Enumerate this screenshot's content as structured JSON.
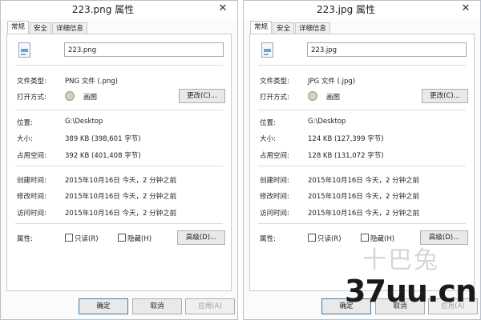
{
  "windows": [
    {
      "title": "223.png 属性",
      "close_glyph": "✕",
      "tabs": [
        "常规",
        "安全",
        "详细信息"
      ],
      "filename": "223.png",
      "fields": {
        "type_label": "文件类型:",
        "type_value": "PNG 文件 (.png)",
        "open_label": "打开方式:",
        "open_value": "画图",
        "change_button": "更改(C)...",
        "location_label": "位置:",
        "location_value": "G:\\Desktop",
        "size_label": "大小:",
        "size_value": "389 KB (398,601 字节)",
        "disk_label": "占用空间:",
        "disk_value": "392 KB (401,408 字节)",
        "created_label": "创建时间:",
        "created_value": "2015年10月16日 今天，2 分钟之前",
        "modified_label": "修改时间:",
        "modified_value": "2015年10月16日 今天，2 分钟之前",
        "accessed_label": "访问时间:",
        "accessed_value": "2015年10月16日 今天，2 分钟之前",
        "attr_label": "属性:",
        "readonly": "只读(R)",
        "hidden": "隐藏(H)",
        "advanced_button": "高级(D)..."
      },
      "footer": {
        "ok": "确定",
        "cancel": "取消",
        "apply": "应用(A)"
      }
    },
    {
      "title": "223.jpg 属性",
      "close_glyph": "✕",
      "tabs": [
        "常规",
        "安全",
        "详细信息"
      ],
      "filename": "223.jpg",
      "fields": {
        "type_label": "文件类型:",
        "type_value": "JPG 文件 (.jpg)",
        "open_label": "打开方式:",
        "open_value": "画图",
        "change_button": "更改(C)...",
        "location_label": "位置:",
        "location_value": "G:\\Desktop",
        "size_label": "大小:",
        "size_value": "124 KB (127,399 字节)",
        "disk_label": "占用空间:",
        "disk_value": "128 KB (131,072 字节)",
        "created_label": "创建时间:",
        "created_value": "2015年10月16日 今天，2 分钟之前",
        "modified_label": "修改时间:",
        "modified_value": "2015年10月16日 今天，2 分钟之前",
        "accessed_label": "访问时间:",
        "accessed_value": "2015年10月16日 今天，2 分钟之前",
        "attr_label": "属性:",
        "readonly": "只读(R)",
        "hidden": "隐藏(H)",
        "advanced_button": "高级(D)..."
      },
      "footer": {
        "ok": "确定",
        "cancel": "取消",
        "apply": "应用(A)"
      }
    }
  ],
  "watermark": {
    "text": "37uu.cn",
    "mark": "十巴兔"
  }
}
